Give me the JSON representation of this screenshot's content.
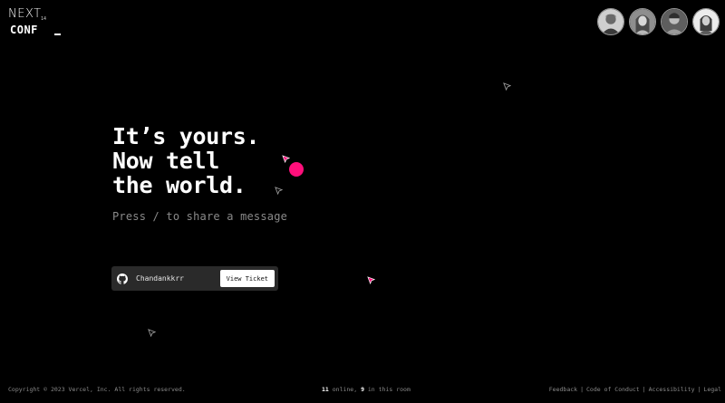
{
  "logo": {
    "next": "NEXT",
    "version": "14",
    "conf": "CONF"
  },
  "avatars": [
    {
      "name": "attendee-1"
    },
    {
      "name": "attendee-2"
    },
    {
      "name": "attendee-3"
    },
    {
      "name": "attendee-4"
    }
  ],
  "hero": {
    "line1": "It’s yours.",
    "line2": "Now tell",
    "line3": "the world.",
    "prompt": "Press / to share a message"
  },
  "ticket": {
    "username": "Chandankkrr",
    "button_label": "View Ticket",
    "icon": "github-icon"
  },
  "cursors": {
    "default_color": "#9a9a9a",
    "highlight_color": "#ff0f7b"
  },
  "footer": {
    "copyright": "Copyright © 2023 Vercel, Inc. All rights reserved.",
    "online_count": "11",
    "online_label": " online, ",
    "room_count": "9",
    "room_label": " in this room",
    "links": {
      "feedback": "Feedback",
      "code_of_conduct": "Code of Conduct",
      "accessibility": "Accessibility",
      "legal": "Legal"
    }
  },
  "colors": {
    "background": "#000000",
    "accent": "#ff0f7b",
    "muted_text": "#8a8a8a"
  }
}
